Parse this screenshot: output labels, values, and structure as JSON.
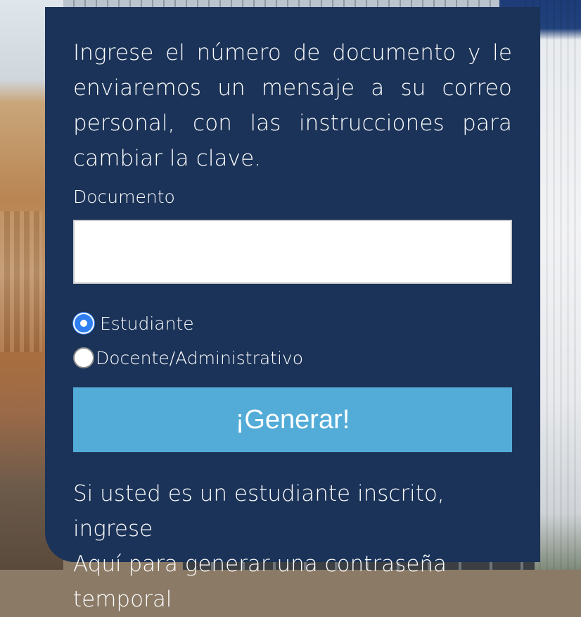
{
  "form": {
    "intro_text": "Ingrese el número de documento y le enviaremos un mensaje a su correo personal, con las instrucciones para cambiar la clave.",
    "document_label": "Documento",
    "document_value": "",
    "user_types": [
      {
        "label": "Estudiante",
        "selected": true
      },
      {
        "label": "Docente/Administrativo",
        "selected": false
      }
    ],
    "submit_label": "¡Generar!",
    "footer_line1": "Si usted es un estudiante inscrito, ingrese",
    "footer_link": "Aquí",
    "footer_line2_rest": " para generar una contraseña temporal"
  },
  "colors": {
    "card_background": "#1b3358",
    "button_background": "#53acd8",
    "radio_selected": "#2f7ff0",
    "text": "#ffffff"
  }
}
